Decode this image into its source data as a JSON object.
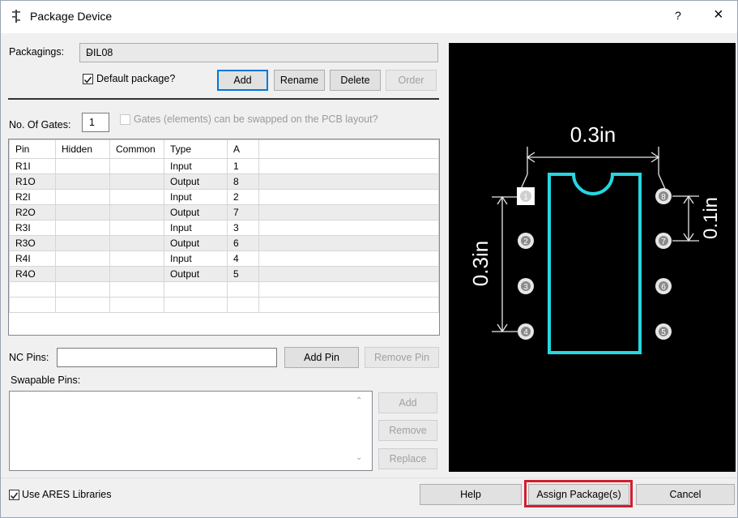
{
  "window": {
    "title": "Package Device",
    "help_glyph": "?",
    "close_glyph": "×"
  },
  "packagings": {
    "label": "Packagings:",
    "value": "DIL08"
  },
  "default_package": {
    "label": "Default package?",
    "checked": true
  },
  "pkg_buttons": {
    "add": "Add",
    "rename": "Rename",
    "delete": "Delete",
    "order": "Order"
  },
  "gates": {
    "label": "No. Of Gates:",
    "value": "1",
    "swap_label": "Gates (elements) can be swapped on the PCB layout?"
  },
  "pin_table": {
    "headers": [
      "Pin",
      "Hidden",
      "Common",
      "Type",
      "A"
    ],
    "rows": [
      [
        "R1I",
        "",
        "",
        "Input",
        "1"
      ],
      [
        "R1O",
        "",
        "",
        "Output",
        "8"
      ],
      [
        "R2I",
        "",
        "",
        "Input",
        "2"
      ],
      [
        "R2O",
        "",
        "",
        "Output",
        "7"
      ],
      [
        "R3I",
        "",
        "",
        "Input",
        "3"
      ],
      [
        "R3O",
        "",
        "",
        "Output",
        "6"
      ],
      [
        "R4I",
        "",
        "",
        "Input",
        "4"
      ],
      [
        "R4O",
        "",
        "",
        "Output",
        "5"
      ],
      [
        "",
        "",
        "",
        "",
        ""
      ]
    ]
  },
  "nc_pins": {
    "label": "NC Pins:",
    "value": "",
    "add_pin": "Add Pin",
    "remove_pin": "Remove Pin"
  },
  "swapable": {
    "label": "Swapable Pins:",
    "add": "Add",
    "remove": "Remove",
    "replace": "Replace"
  },
  "use_ares": {
    "label": "Use ARES Libraries",
    "checked": true
  },
  "footer": {
    "help": "Help",
    "assign": "Assign Package(s)",
    "cancel": "Cancel"
  },
  "preview": {
    "width_dim": "0.3in",
    "height_dim": "0.3in",
    "pitch_dim": "0.1in",
    "left_pins": [
      "1",
      "2",
      "3",
      "4"
    ],
    "right_pins": [
      "8",
      "7",
      "6",
      "5"
    ],
    "outline_color": "#26d6e0",
    "background": "#000000"
  }
}
